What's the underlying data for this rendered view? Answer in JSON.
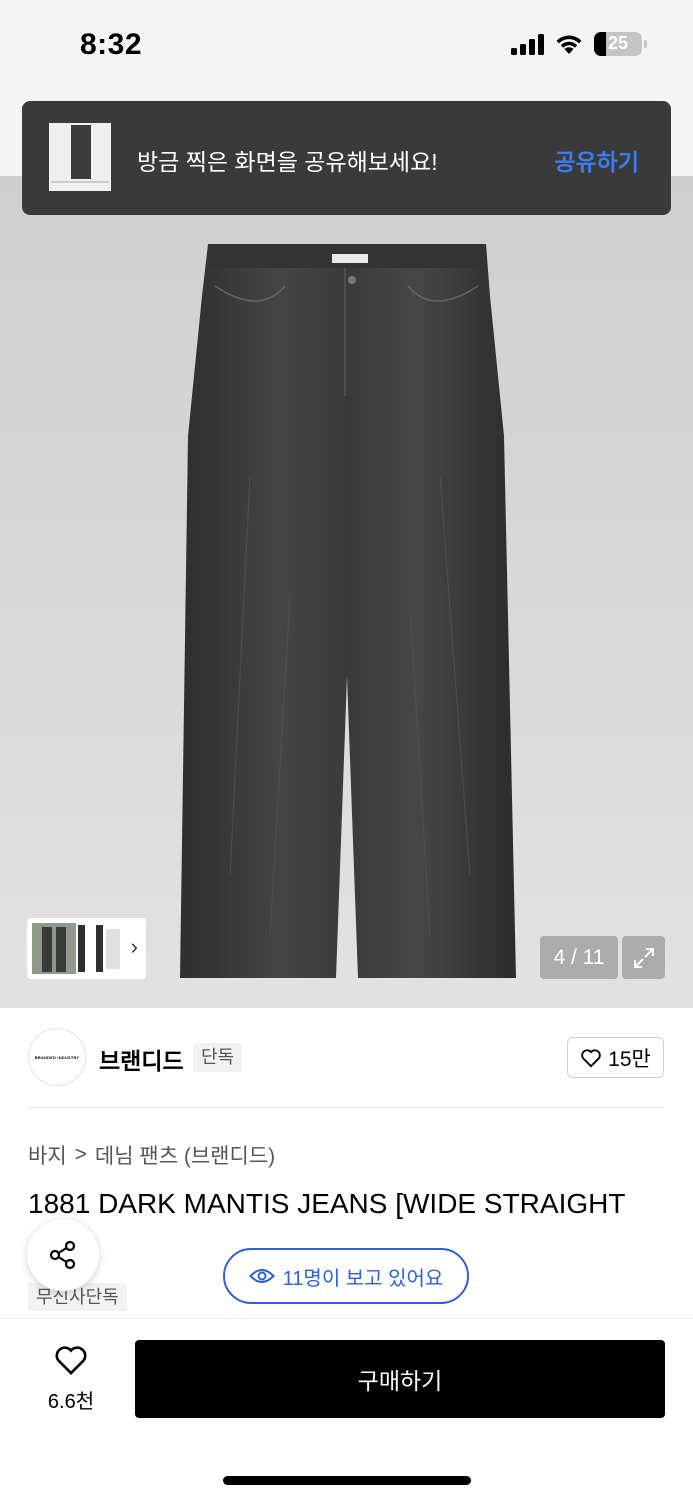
{
  "status_bar": {
    "time": "8:32",
    "battery": "25",
    "icons": [
      "signal-icon",
      "wifi-icon",
      "battery-icon"
    ]
  },
  "toast": {
    "message": "방금 찍은 화면을 공유해보세요!",
    "action_label": "공유하기",
    "accent_color": "#3b7bf6"
  },
  "gallery": {
    "counter": "4 / 11",
    "thumbnail_next_icon": "chevron-right-icon",
    "expand_icon": "expand-icon"
  },
  "brand": {
    "logo_text": "BRANDED INDUSTRY",
    "name": "브랜디드",
    "badge": "단독",
    "likes": "15만"
  },
  "breadcrumb": {
    "category": "바지",
    "separator": ">",
    "subcategory": "데님 팬츠 (브랜디드)"
  },
  "product": {
    "title": "1881 DARK MANTIS JEANS [WIDE STRAIGHT",
    "tag": "무신사단독"
  },
  "viewers": {
    "text": "11명이 보고 있어요",
    "color": "#2f5fd8"
  },
  "bottom_bar": {
    "wish_count": "6.6천",
    "buy_label": "구매하기"
  }
}
